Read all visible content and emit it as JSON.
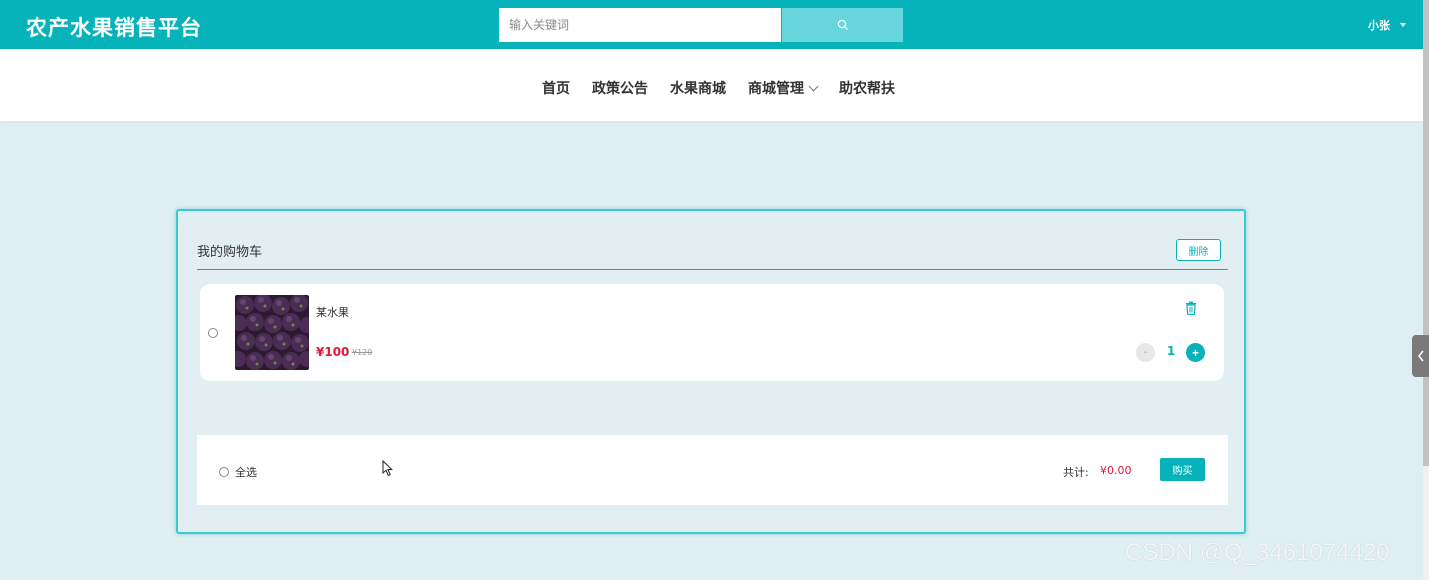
{
  "header": {
    "brand": "农产水果销售平台",
    "search": {
      "placeholder": "输入关键词"
    },
    "user": "小张",
    "accent_color": "#06b3bb"
  },
  "nav": {
    "items": [
      {
        "label": "首页"
      },
      {
        "label": "政策公告"
      },
      {
        "label": "水果商城"
      },
      {
        "label": "商城管理",
        "has_dropdown": true
      },
      {
        "label": "助农帮扶"
      }
    ]
  },
  "cart": {
    "title": "我的购物车",
    "delete_label": "删除",
    "items": [
      {
        "name": "某水果",
        "price": "¥100",
        "original_price": "¥120",
        "quantity": "1",
        "minus_label": "-",
        "plus_label": "+",
        "selected": false
      }
    ],
    "footer": {
      "select_all_label": "全选",
      "total_label": "共计:",
      "total_value": "¥0.00",
      "buy_label": "购买"
    }
  },
  "watermark": "CSDN @Q_3461074420",
  "price_color": "#e5163b"
}
